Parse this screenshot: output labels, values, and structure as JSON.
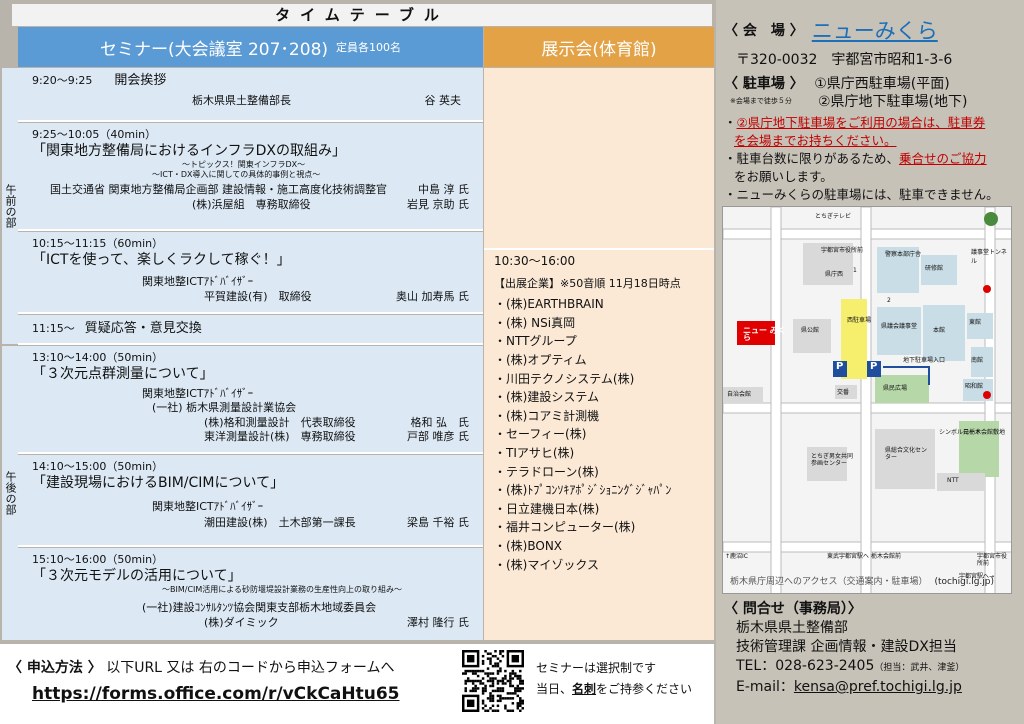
{
  "timetable_title": "タイムテーブル",
  "seminar_header": {
    "label": "セミナー(大会議室 207･208)",
    "capacity": "定員各100名"
  },
  "exhibit_header": {
    "label": "展示会(体育館)"
  },
  "side_labels": {
    "am": "午前の部",
    "pm": "午後の部"
  },
  "sessions": [
    {
      "time": "9:20～9:25",
      "title": "開会挨拶",
      "org": "栃木県県土整備部長",
      "person": "谷 英夫"
    },
    {
      "time": "9:25～10:05（40min）",
      "title": "「関東地方整備局におけるインフラDXの取組み」",
      "sub1": "～トピックス！関東インフラDX～",
      "sub2": "～ICT・DX導入に関しての具体的事例と視点～",
      "speakers": [
        {
          "org": "国土交通省 関東地方整備局企画部 建設情報・施工高度化技術調整官",
          "person": "中島 淳 氏"
        },
        {
          "org": "(株)浜屋組　専務取締役",
          "person": "岩見 京助 氏"
        }
      ]
    },
    {
      "time": "10:15～11:15（60min）",
      "title": "「ICTを使って、楽しくラクして稼ぐ！」",
      "advisor": "関東地整ICTｱﾄﾞﾊﾞｲｻﾞｰ",
      "speakers": [
        {
          "org": "平賀建設(有)　取締役",
          "person": "奥山 加寿馬 氏"
        }
      ]
    },
    {
      "time": "11:15～",
      "title": "質疑応答・意見交換"
    },
    {
      "time": "13:10～14:00（50min）",
      "title": "「３次元点群測量について」",
      "advisor": "関東地整ICTｱﾄﾞﾊﾞｲｻﾞｰ",
      "assoc": "(一社) 栃木県測量設計業協会",
      "speakers": [
        {
          "org": "(株)格和測量設計　代表取締役",
          "person": "格和 弘　氏"
        },
        {
          "org": "東洋測量設計(株)　専務取締役",
          "person": "戸部 唯彦 氏"
        }
      ]
    },
    {
      "time": "14:10～15:00（50min）",
      "title": "「建設現場におけるBIM/CIMについて」",
      "advisor": "関東地整ICTｱﾄﾞﾊﾞｲｻﾞｰ",
      "speakers": [
        {
          "org": "潮田建設(株)　土木部第一課長",
          "person": "梁島 千裕 氏"
        }
      ]
    },
    {
      "time": "15:10～16:00（50min）",
      "title": "「３次元モデルの活用について」",
      "sub1": "～BIM/CIM活用による砂防堰堤設計業務の生産性向上の取り組み～",
      "assoc": "(一社)建設ｺﾝｻﾙﾀﾝﾂ協会関東支部栃木地域委員会",
      "speakers": [
        {
          "org": "(株)ダイミック",
          "person": "澤村 隆行 氏"
        }
      ]
    }
  ],
  "exhibit": {
    "time": "10:30～16:00",
    "header": "【出展企業】※50音順 11月18日時点",
    "companies": [
      "・(株)EARTHBRAIN",
      "・(株) NSi真岡",
      "・NTTグループ",
      "・(株)オプティム",
      "・川田テクノシステム(株)",
      "・(株)建設システム",
      "・(株)コアミ計測機",
      "・セーフィー(株)",
      "・TIアサヒ(株)",
      "・テラドローン(株)",
      "・(株)ﾄﾌﾟｺﾝｿｷｱﾎﾟｼﾞｼｮﾆﾝｸﾞｼﾞｬﾊﾟﾝ",
      "・日立建機日本(株)",
      "・福井コンピューター(株)",
      "・(株)BONX",
      "・(株)マイゾックス"
    ]
  },
  "application": {
    "label": "〈 申込方法 〉",
    "text": "以下URL 又は 右のコードから申込フォームへ",
    "url": "https://forms.office.com/r/vCkCaHtu65",
    "note1": "セミナーは選択制です",
    "note2_a": "当日、",
    "note2_b": "名刺",
    "note2_c": "をご持参ください"
  },
  "venue": {
    "label": "〈 会　場 〉",
    "name": "ニューみくら",
    "address": "〒320-0032　宇都宮市昭和1-3-6"
  },
  "parking": {
    "label": "〈 駐車場 〉",
    "walk": "※会場まで徒歩５分",
    "lot1": "①県庁西駐車場(平面)",
    "lot2": "②県庁地下駐車場(地下)",
    "notes": [
      {
        "prefix": "・",
        "red": "②県庁地下駐車場をご利用の場合は、駐車券",
        "plain": ""
      },
      {
        "prefix": "",
        "red": "",
        "plain": "を会場までお持ちください。"
      },
      {
        "prefix": "・",
        "red": "",
        "plain": "駐車台数に限りがあるため、",
        "red2": "乗合せのご協力"
      },
      {
        "prefix": "",
        "red": "",
        "plain": "をお願いします。"
      },
      {
        "prefix": "・",
        "red": "",
        "plain": "ニューみくらの駐車場には、駐車できません。"
      }
    ]
  },
  "map": {
    "labels": [
      "とちぎテレビ",
      "宇都宮市役所前",
      "警察本部庁舎",
      "研修館",
      "県庁西",
      "県公館",
      "西駐車場",
      "県議会議事堂",
      "本館",
      "東館",
      "南館",
      "地下駐車場入口",
      "昭和館",
      "県民広場",
      "交番",
      "自治会館",
      "県総合文化センター",
      "元栃木会館敷地",
      "シンボルロード",
      "とちぎ男女共同参画センター",
      "NTT",
      "栃木会館前",
      "東武宇都宮駅へ",
      "↑鹿沼IC",
      "宇都宮市役所前",
      "宇都宮駅へ→",
      "ニュー みくら",
      "P",
      "P",
      "1",
      "2"
    ],
    "caption": "栃木県庁周辺へのアクセス（交通案内・駐車場）",
    "caption_url": "(tochigi.lg.jp)",
    "tunnel": "議事堂トンネル"
  },
  "contact": {
    "label": "〈 問合せ（事務局）〉",
    "dept": "栃木県県土整備部",
    "section": "技術管理課 企画情報・建設DX担当",
    "tel": "TEL：028-623-2405",
    "tel_note": "（担当：武井、津釜）",
    "email_label": "E-mail：",
    "email": "kensa@pref.tochigi.lg.jp"
  }
}
